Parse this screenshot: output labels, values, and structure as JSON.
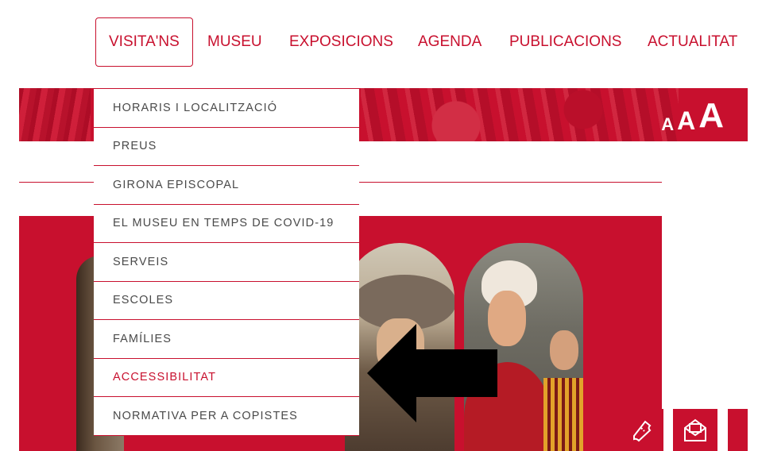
{
  "nav": {
    "items": [
      {
        "label": "VISITA'NS",
        "active": true
      },
      {
        "label": "MUSEU"
      },
      {
        "label": "EXPOSICIONS"
      },
      {
        "label": "AGENDA"
      },
      {
        "label": "PUBLICACIONS"
      },
      {
        "label": "ACTUALITAT"
      }
    ]
  },
  "banner": {
    "font_size_controls": [
      "A",
      "A",
      "A"
    ]
  },
  "dropdown": {
    "items": [
      {
        "label": "HORARIS I LOCALITZACIÓ"
      },
      {
        "label": "PREUS"
      },
      {
        "label": "GIRONA EPISCOPAL"
      },
      {
        "label": "EL MUSEU EN TEMPS DE COVID-19"
      },
      {
        "label": "SERVEIS"
      },
      {
        "label": "ESCOLES"
      },
      {
        "label": "FAMÍLIES"
      },
      {
        "label": "ACCESSIBILITAT",
        "active": true
      },
      {
        "label": "NORMATIVA PER A COPISTES"
      }
    ]
  },
  "actions": {
    "icons": [
      "ticket-icon",
      "newsletter-icon",
      "more-icon"
    ]
  },
  "colors": {
    "brand_red": "#c8102e",
    "menu_text": "#4a4a4a",
    "background": "#ffffff"
  }
}
